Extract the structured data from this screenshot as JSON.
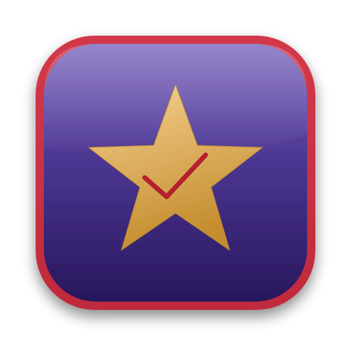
{
  "app_icon": {
    "icon": "star-check-icon",
    "colors": {
      "border": "#d2394b",
      "background_top": "#7a63bd",
      "background_bottom": "#27175c",
      "star_light": "#f3d290",
      "star_dark": "#c48d2e",
      "checkmark": "#b51f2e"
    }
  }
}
